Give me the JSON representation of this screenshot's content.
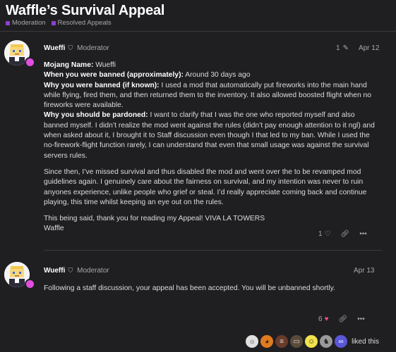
{
  "topic": {
    "title": "Waffle’s Survival Appeal",
    "categories": [
      "Moderation",
      "Resolved Appeals"
    ]
  },
  "post1": {
    "username": "Wueffi",
    "role": "Moderator",
    "edit_count": "1",
    "date": "Apr 12",
    "fields": [
      {
        "label": "Mojang Name:",
        "value": " Wueffi"
      },
      {
        "label": "When you were banned (approximately):",
        "value": " Around 30 days ago"
      },
      {
        "label": "Why you were banned (if known):",
        "value": " I used a mod that automatically put fireworks into the main hand while flying, fired them, and then returned them to the inventory. It also allowed boosted flight when no fireworks were available."
      },
      {
        "label": "Why you should be pardoned:",
        "value": " I want to clarify that I was the one who reported myself and also banned myself. I didn’t realize the mod went against the rules (didn’t pay enough attention to it ngl) and when asked about it, I brought it to Staff discussion even though I that led to my ban. While I used the no-firework-flight function rarely, I can understand that even that small usage was against the survival servers rules."
      }
    ],
    "paragraph2": "Since then, I’ve missed survival and thus disabled the mod and went over the to be revamped mod guidelines again. I genuinely care about the fairness on survival, and my intention was never to ruin anyones experience, unlike people who grief or steal. I’d really appreciate coming back and continue playing, this time whilst keeping an eye out on the rules.",
    "closing_line1": "This being said, thank you for reading my Appeal! VIVA LA TOWERS",
    "closing_line2": "Waffle",
    "like_count": "1"
  },
  "post2": {
    "username": "Wueffi",
    "role": "Moderator",
    "date": "Apr 13",
    "body": "Following a staff discussion, your appeal has been accepted. You will be unbanned shortly.",
    "like_count": "6",
    "liked_text": "liked this"
  },
  "colors": {
    "background": "#1f1f22",
    "category": "#8b3fd1",
    "heart": "#e8557a",
    "status_dot": "#e24ee0"
  }
}
